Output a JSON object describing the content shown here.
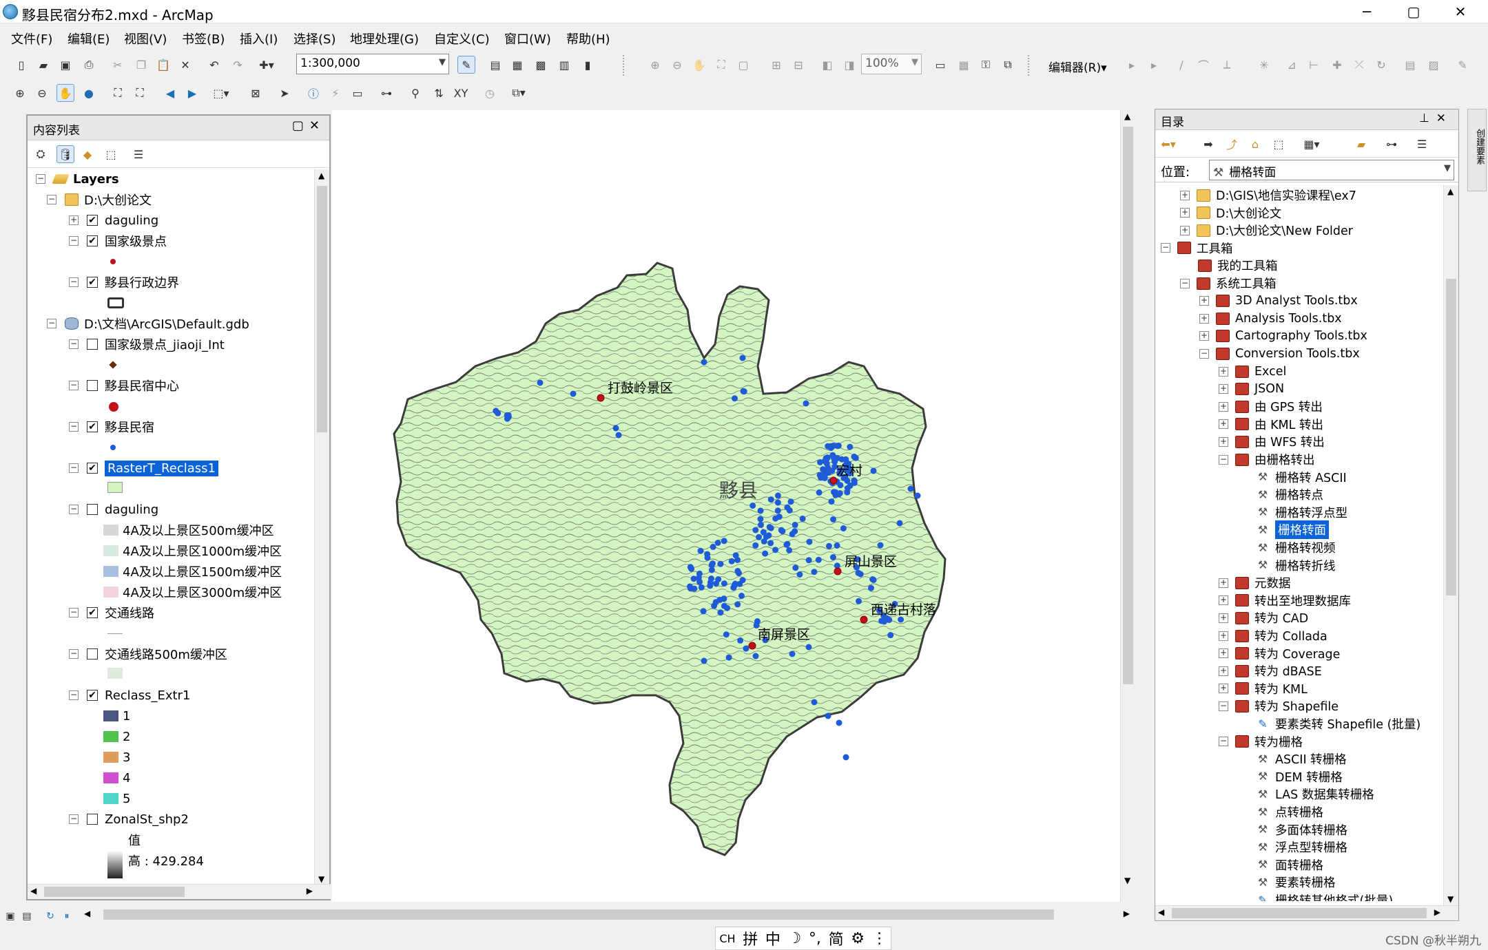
{
  "window": {
    "title": "黟县民宿分布2.mxd - ArcMap",
    "min": "─",
    "max": "▢",
    "close": "✕"
  },
  "menu": [
    "文件(F)",
    "编辑(E)",
    "视图(V)",
    "书签(B)",
    "插入(I)",
    "选择(S)",
    "地理处理(G)",
    "自定义(C)",
    "窗口(W)",
    "帮助(H)"
  ],
  "toolbar": {
    "scale": "1:300,000",
    "zoom": "100%",
    "editor": "编辑器(R)▾"
  },
  "toc": {
    "title": "内容列表",
    "layers": "Layers",
    "rows": [
      {
        "label": "D:\\大创论文",
        "level": 1,
        "type": "folder",
        "exp": "−"
      },
      {
        "label": "daguling",
        "level": 2,
        "check": true,
        "exp": "+"
      },
      {
        "label": "国家级景点",
        "level": 2,
        "check": true,
        "exp": "−"
      },
      {
        "label": "黟县行政边界",
        "level": 2,
        "check": true,
        "exp": "−"
      },
      {
        "label": "D:\\文档\\ArcGIS\\Default.gdb",
        "level": 1,
        "type": "gdb",
        "exp": "−"
      },
      {
        "label": "国家级景点_jiaoji_Int",
        "level": 2,
        "check": false,
        "exp": "−"
      },
      {
        "label": "黟县民宿中心",
        "level": 2,
        "check": false,
        "exp": "−"
      },
      {
        "label": "黟县民宿",
        "level": 2,
        "check": true,
        "exp": "−"
      },
      {
        "label": "RasterT_Reclass1",
        "level": 2,
        "check": true,
        "exp": "−",
        "selected": true
      },
      {
        "label": "daguling",
        "level": 2,
        "check": false,
        "exp": "−"
      },
      {
        "label": "4A及以上景区500m缓冲区",
        "level": 3,
        "color": "#d8d8d8"
      },
      {
        "label": "4A及以上景区1000m缓冲区",
        "level": 3,
        "color": "#d6ecdf"
      },
      {
        "label": "4A及以上景区1500m缓冲区",
        "level": 3,
        "color": "#a9bfe0"
      },
      {
        "label": "4A及以上景区3000m缓冲区",
        "level": 3,
        "color": "#f3d3df"
      },
      {
        "label": "交通线路",
        "level": 2,
        "check": true,
        "exp": "−"
      },
      {
        "label": "交通线路500m缓冲区",
        "level": 2,
        "check": false,
        "exp": "−"
      },
      {
        "label": "Reclass_Extr1",
        "level": 2,
        "check": true,
        "exp": "−"
      },
      {
        "label": "1",
        "level": 3,
        "color": "#4a5680"
      },
      {
        "label": "2",
        "level": 3,
        "color": "#4fc24f"
      },
      {
        "label": "3",
        "level": 3,
        "color": "#e09c5a"
      },
      {
        "label": "4",
        "level": 3,
        "color": "#d24fd2"
      },
      {
        "label": "5",
        "level": 3,
        "color": "#4fd6c6"
      },
      {
        "label": "ZonalSt_shp2",
        "level": 2,
        "check": false,
        "exp": "−"
      },
      {
        "label": "值",
        "level": 3
      },
      {
        "label": "高 : 429.284",
        "level": 3
      }
    ]
  },
  "map": {
    "labels": [
      "打鼓岭景区",
      "宏村",
      "黟县",
      "屏山景区",
      "西递古村落",
      "南屏景区"
    ]
  },
  "catalog": {
    "title": "目录",
    "location_label": "位置:",
    "location_value": "栅格转面",
    "rows": [
      {
        "label": "D:\\GIS\\地信实验课程\\ex7",
        "level": 1,
        "icon": "folder",
        "exp": "+"
      },
      {
        "label": "D:\\大创论文",
        "level": 1,
        "icon": "folder",
        "exp": "+"
      },
      {
        "label": "D:\\大创论文\\New Folder",
        "level": 1,
        "icon": "folder",
        "exp": "+"
      },
      {
        "label": "工具箱",
        "level": 0,
        "icon": "tbx",
        "exp": "−"
      },
      {
        "label": "我的工具箱",
        "level": 1,
        "icon": "tbx"
      },
      {
        "label": "系统工具箱",
        "level": 1,
        "icon": "tbx",
        "exp": "−"
      },
      {
        "label": "3D Analyst Tools.tbx",
        "level": 2,
        "icon": "tbx",
        "exp": "+"
      },
      {
        "label": "Analysis Tools.tbx",
        "level": 2,
        "icon": "tbx",
        "exp": "+"
      },
      {
        "label": "Cartography Tools.tbx",
        "level": 2,
        "icon": "tbx",
        "exp": "+"
      },
      {
        "label": "Conversion Tools.tbx",
        "level": 2,
        "icon": "tbx",
        "exp": "−"
      },
      {
        "label": "Excel",
        "level": 3,
        "icon": "tbx",
        "exp": "+"
      },
      {
        "label": "JSON",
        "level": 3,
        "icon": "tbx",
        "exp": "+"
      },
      {
        "label": "由 GPS 转出",
        "level": 3,
        "icon": "tbx",
        "exp": "+"
      },
      {
        "label": "由 KML 转出",
        "level": 3,
        "icon": "tbx",
        "exp": "+"
      },
      {
        "label": "由 WFS 转出",
        "level": 3,
        "icon": "tbx",
        "exp": "+"
      },
      {
        "label": "由栅格转出",
        "level": 3,
        "icon": "tbx",
        "exp": "−"
      },
      {
        "label": "栅格转 ASCII",
        "level": 4,
        "icon": "hammer"
      },
      {
        "label": "栅格转点",
        "level": 4,
        "icon": "hammer"
      },
      {
        "label": "栅格转浮点型",
        "level": 4,
        "icon": "hammer"
      },
      {
        "label": "栅格转面",
        "level": 4,
        "icon": "hammer",
        "selected": true
      },
      {
        "label": "栅格转视频",
        "level": 4,
        "icon": "hammer"
      },
      {
        "label": "栅格转折线",
        "level": 4,
        "icon": "hammer"
      },
      {
        "label": "元数据",
        "level": 3,
        "icon": "tbx",
        "exp": "+"
      },
      {
        "label": "转出至地理数据库",
        "level": 3,
        "icon": "tbx",
        "exp": "+"
      },
      {
        "label": "转为 CAD",
        "level": 3,
        "icon": "tbx",
        "exp": "+"
      },
      {
        "label": "转为 Collada",
        "level": 3,
        "icon": "tbx",
        "exp": "+"
      },
      {
        "label": "转为 Coverage",
        "level": 3,
        "icon": "tbx",
        "exp": "+"
      },
      {
        "label": "转为 dBASE",
        "level": 3,
        "icon": "tbx",
        "exp": "+"
      },
      {
        "label": "转为 KML",
        "level": 3,
        "icon": "tbx",
        "exp": "+"
      },
      {
        "label": "转为 Shapefile",
        "level": 3,
        "icon": "tbx",
        "exp": "−"
      },
      {
        "label": "要素类转 Shapefile (批量)",
        "level": 4,
        "icon": "script"
      },
      {
        "label": "转为栅格",
        "level": 3,
        "icon": "tbx",
        "exp": "−"
      },
      {
        "label": "ASCII 转栅格",
        "level": 4,
        "icon": "hammer"
      },
      {
        "label": "DEM 转栅格",
        "level": 4,
        "icon": "hammer"
      },
      {
        "label": "LAS 数据集转栅格",
        "level": 4,
        "icon": "hammer"
      },
      {
        "label": "点转栅格",
        "level": 4,
        "icon": "hammer"
      },
      {
        "label": "多面体转栅格",
        "level": 4,
        "icon": "hammer"
      },
      {
        "label": "浮点型转栅格",
        "level": 4,
        "icon": "hammer"
      },
      {
        "label": "面转栅格",
        "level": 4,
        "icon": "hammer"
      },
      {
        "label": "要素转栅格",
        "level": 4,
        "icon": "hammer"
      },
      {
        "label": "栅格转其他格式(批量)",
        "level": 4,
        "icon": "script"
      }
    ]
  },
  "side_tab": "创建要素",
  "ime": [
    "CH",
    "拼",
    "中",
    "☽",
    "°,",
    "简",
    "⚙",
    "⋮"
  ],
  "watermark": "CSDN @秋半朔九"
}
